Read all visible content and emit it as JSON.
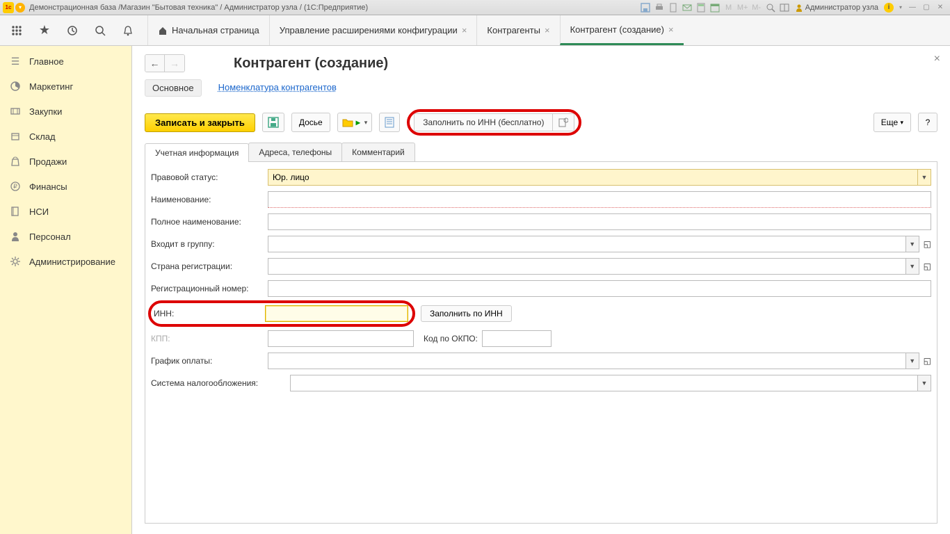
{
  "titlebar": {
    "text": "Демонстрационная база /Магазин \"Бытовая техника\" / Администратор узла /  (1С:Предприятие)",
    "user": "Администратор узла"
  },
  "mem": {
    "m": "M",
    "mplus": "M+",
    "mminus": "M-"
  },
  "tabs": {
    "home": "Начальная страница",
    "t1": "Управление расширениями конфигурации",
    "t2": "Контрагенты",
    "t3": "Контрагент (создание)"
  },
  "sidebar": {
    "main": "Главное",
    "marketing": "Маркетинг",
    "purchases": "Закупки",
    "warehouse": "Склад",
    "sales": "Продажи",
    "finances": "Финансы",
    "nsi": "НСИ",
    "personnel": "Персонал",
    "admin": "Администрирование"
  },
  "page": {
    "title": "Контрагент (создание)",
    "subnav_main": "Основное",
    "subnav_nom": "Номенклатура контрагентов"
  },
  "toolbar": {
    "save_close": "Записать и закрыть",
    "dossier": "Досье",
    "fill_inn_free": "Заполнить по ИНН (бесплатно)",
    "more": "Еще",
    "help": "?"
  },
  "formtabs": {
    "t1": "Учетная информация",
    "t2": "Адреса, телефоны",
    "t3": "Комментарий"
  },
  "form": {
    "legal_status_label": "Правовой статус:",
    "legal_status_value": "Юр. лицо",
    "name_label": "Наименование:",
    "full_name_label": "Полное наименование:",
    "group_label": "Входит в группу:",
    "country_label": "Страна регистрации:",
    "reg_num_label": "Регистрационный номер:",
    "inn_label": "ИНН:",
    "fill_inn": "Заполнить по ИНН",
    "kpp_label": "КПП:",
    "okpo_label": "Код по ОКПО:",
    "payment_label": "График оплаты:",
    "tax_label": "Система налогообложения:"
  }
}
